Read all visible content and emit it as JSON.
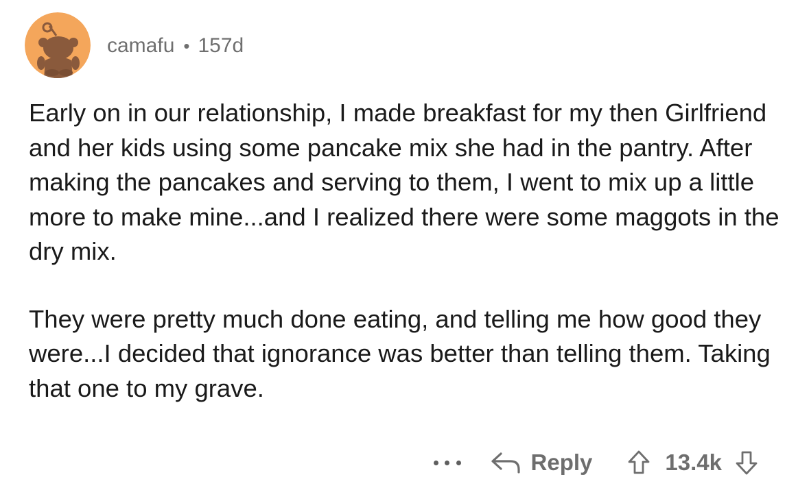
{
  "comment": {
    "username": "camafu",
    "separator": "•",
    "age": "157d",
    "paragraphs": [
      "Early on in our relationship, I made breakfast for my then Girlfriend and her kids using some pancake mix she had in the pantry. After making the pancakes and serving to them, I went to mix up a little more to make mine...and I realized there were some maggots in the dry mix.",
      "They were pretty much done eating, and telling me how good they were...I decided that ignorance was better than telling them. Taking that one to my grave."
    ]
  },
  "actions": {
    "more_icon": "ellipsis-icon",
    "reply_label": "Reply",
    "reply_icon": "reply-arrow-icon",
    "upvote_icon": "upvote-arrow-icon",
    "score": "13.4k",
    "downvote_icon": "downvote-arrow-icon"
  },
  "colors": {
    "avatar_bg": "#F4A65B",
    "avatar_figure": "#8A5A3C",
    "meta_text": "#6F6F6F",
    "body_text": "#1A1A1A",
    "action_text": "#6E6E6E"
  }
}
